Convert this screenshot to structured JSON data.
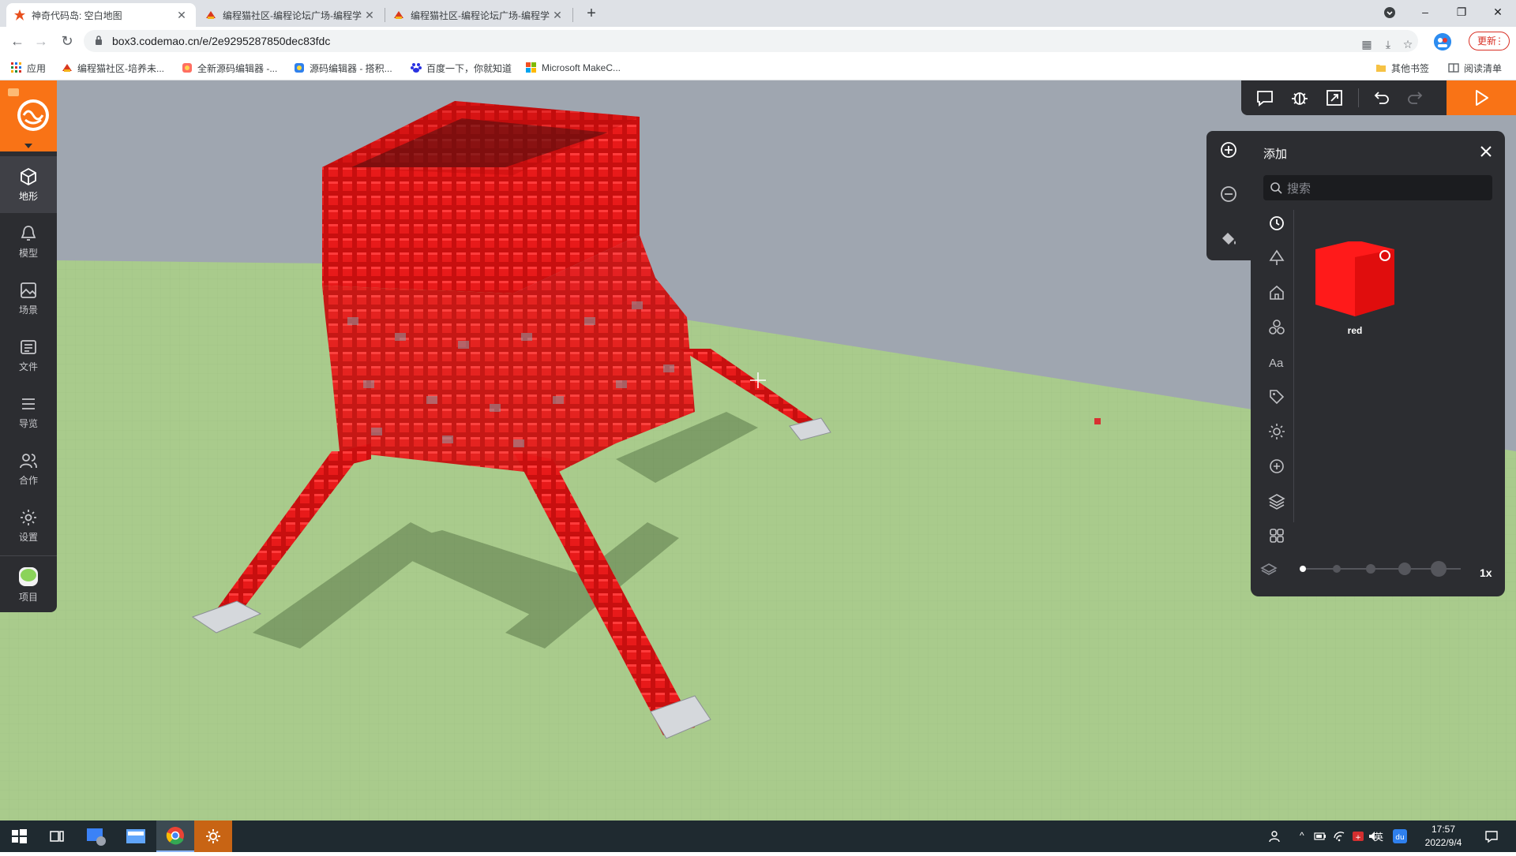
{
  "browser": {
    "tabs": [
      {
        "title": "神奇代码岛: 空白地图",
        "active": true
      },
      {
        "title": "编程猫社区-编程论坛广场-编程学",
        "active": false
      },
      {
        "title": "编程猫社区-编程论坛广场-编程学",
        "active": false
      }
    ],
    "tab_close": "✕",
    "new_tab": "+",
    "window_controls": {
      "minimize": "–",
      "restore": "❐",
      "close": "✕"
    },
    "url": "box3.codemao.cn/e/2e9295287850dec83fdc",
    "update_label": "更新",
    "update_menu": "⋮",
    "bookmarks": [
      {
        "label": "应用",
        "icon": "apps-grid-icon"
      },
      {
        "label": "编程猫社区-培养未...",
        "icon": "codemao-icon"
      },
      {
        "label": "全新源码编辑器 -...",
        "icon": "editor-icon"
      },
      {
        "label": "源码编辑器 - 搭积...",
        "icon": "editor-blue-icon"
      },
      {
        "label": "百度一下，你就知道",
        "icon": "baidu-icon"
      },
      {
        "label": "Microsoft MakeC...",
        "icon": "microsoft-icon"
      }
    ],
    "other_bookmarks": "其他书签",
    "reading_list": "阅读清单"
  },
  "sidebar": {
    "items": [
      {
        "label": "地形",
        "icon": "cube-icon",
        "active": true
      },
      {
        "label": "模型",
        "icon": "bell-model-icon",
        "active": false
      },
      {
        "label": "场景",
        "icon": "image-icon",
        "active": false
      },
      {
        "label": "文件",
        "icon": "file-icon",
        "active": false
      },
      {
        "label": "导览",
        "icon": "list-icon",
        "active": false
      },
      {
        "label": "合作",
        "icon": "users-icon",
        "active": false
      },
      {
        "label": "设置",
        "icon": "gear-icon",
        "active": false
      },
      {
        "label": "项目",
        "icon": "project-icon",
        "active": false
      }
    ]
  },
  "add_panel": {
    "title": "添加",
    "search_placeholder": "搜索",
    "block_name": "red",
    "zoom_label": "1x",
    "slider_steps": 5,
    "slider_selected_step": 1,
    "categories": [
      "history-icon",
      "tree-icon",
      "house-icon",
      "shapes-icon",
      "text-icon",
      "tag-icon",
      "light-icon",
      "plus-circle-icon",
      "layers-icon",
      "grid-icon"
    ]
  },
  "taskbar": {
    "time": "17:57",
    "date": "2022/9/4",
    "ime": "英"
  },
  "colors": {
    "accent": "#f97316",
    "block_red": "#e01010",
    "ground": "#a7c98b",
    "sky": "#9ea6b0",
    "panel_bg": "#2c2d31"
  }
}
